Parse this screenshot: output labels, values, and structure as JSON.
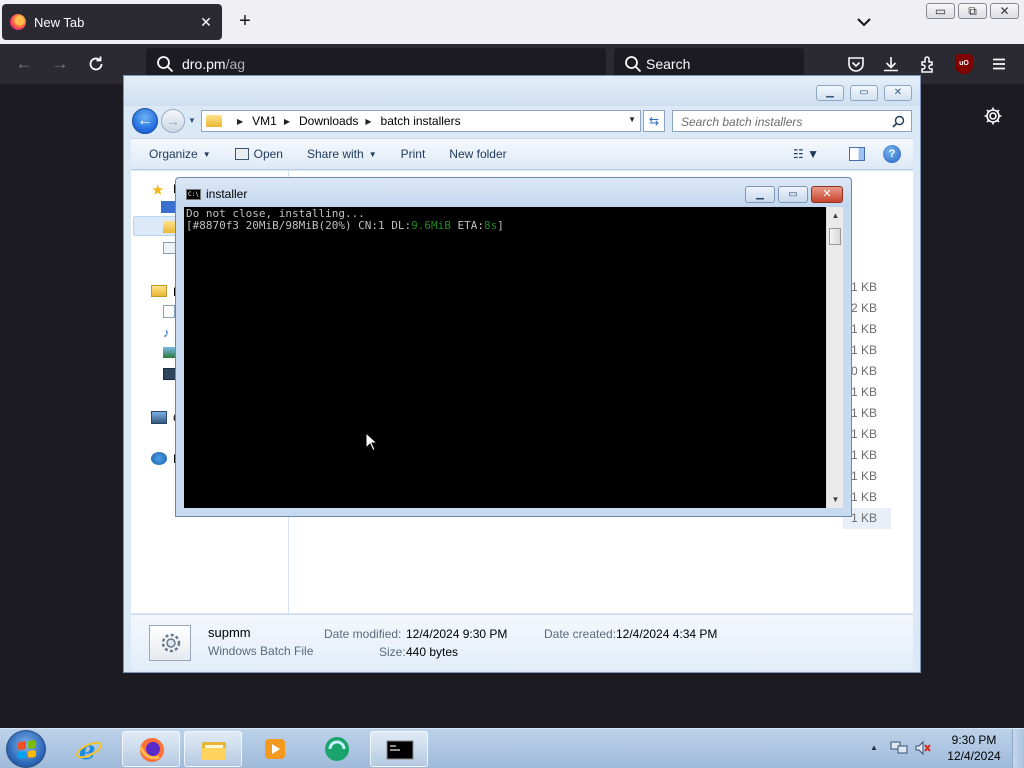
{
  "browser": {
    "tab_title": "New Tab",
    "tab_close": "✕",
    "new_tab": "+",
    "url_host": "dro.pm",
    "url_path": "/ag",
    "search_placeholder": "Search",
    "ublock_label": "uO"
  },
  "explorer": {
    "breadcrumb": [
      "VM1",
      "Downloads",
      "batch installers"
    ],
    "search_placeholder": "Search batch installers",
    "toolbar": {
      "organize": "Organize",
      "open": "Open",
      "share_with": "Share with",
      "print": "Print",
      "new_folder": "New folder"
    },
    "nav_labels": [
      "F",
      "L",
      "C",
      "N"
    ],
    "size_column": [
      "1 KB",
      "2 KB",
      "1 KB",
      "1 KB",
      "0 KB",
      "1 KB",
      "1 KB",
      "1 KB",
      "1 KB",
      "1 KB",
      "1 KB",
      "1 KB"
    ],
    "details": {
      "name": "supmm",
      "type": "Windows Batch File",
      "date_modified_label": "Date modified:",
      "date_modified": "12/4/2024 9:30 PM",
      "date_created_label": "Date created:",
      "date_created": "12/4/2024 4:34 PM",
      "size_label": "Size:",
      "size": "440 bytes"
    }
  },
  "console": {
    "title": "installer",
    "line1": "Do not close, installing...",
    "line2_prefix": "[#8870f3 20MiB/98MiB(20%) CN:1 DL:",
    "line2_dl": "9.6MiB",
    "line2_mid": " ETA:",
    "line2_eta": "8s",
    "line2_suffix": "]"
  },
  "taskbar": {
    "time": "9:30 PM",
    "date": "12/4/2024"
  },
  "icons": {
    "firefox": "firefox-icon",
    "ie": "internet-explorer-icon",
    "explorer": "folder-icon",
    "wmp": "media-player-icon",
    "cmd": "command-prompt-icon"
  },
  "colors": {
    "firefox_dark": "#2b2a33",
    "console_green": "#1f8a1f",
    "close_red": "#c8432b"
  }
}
